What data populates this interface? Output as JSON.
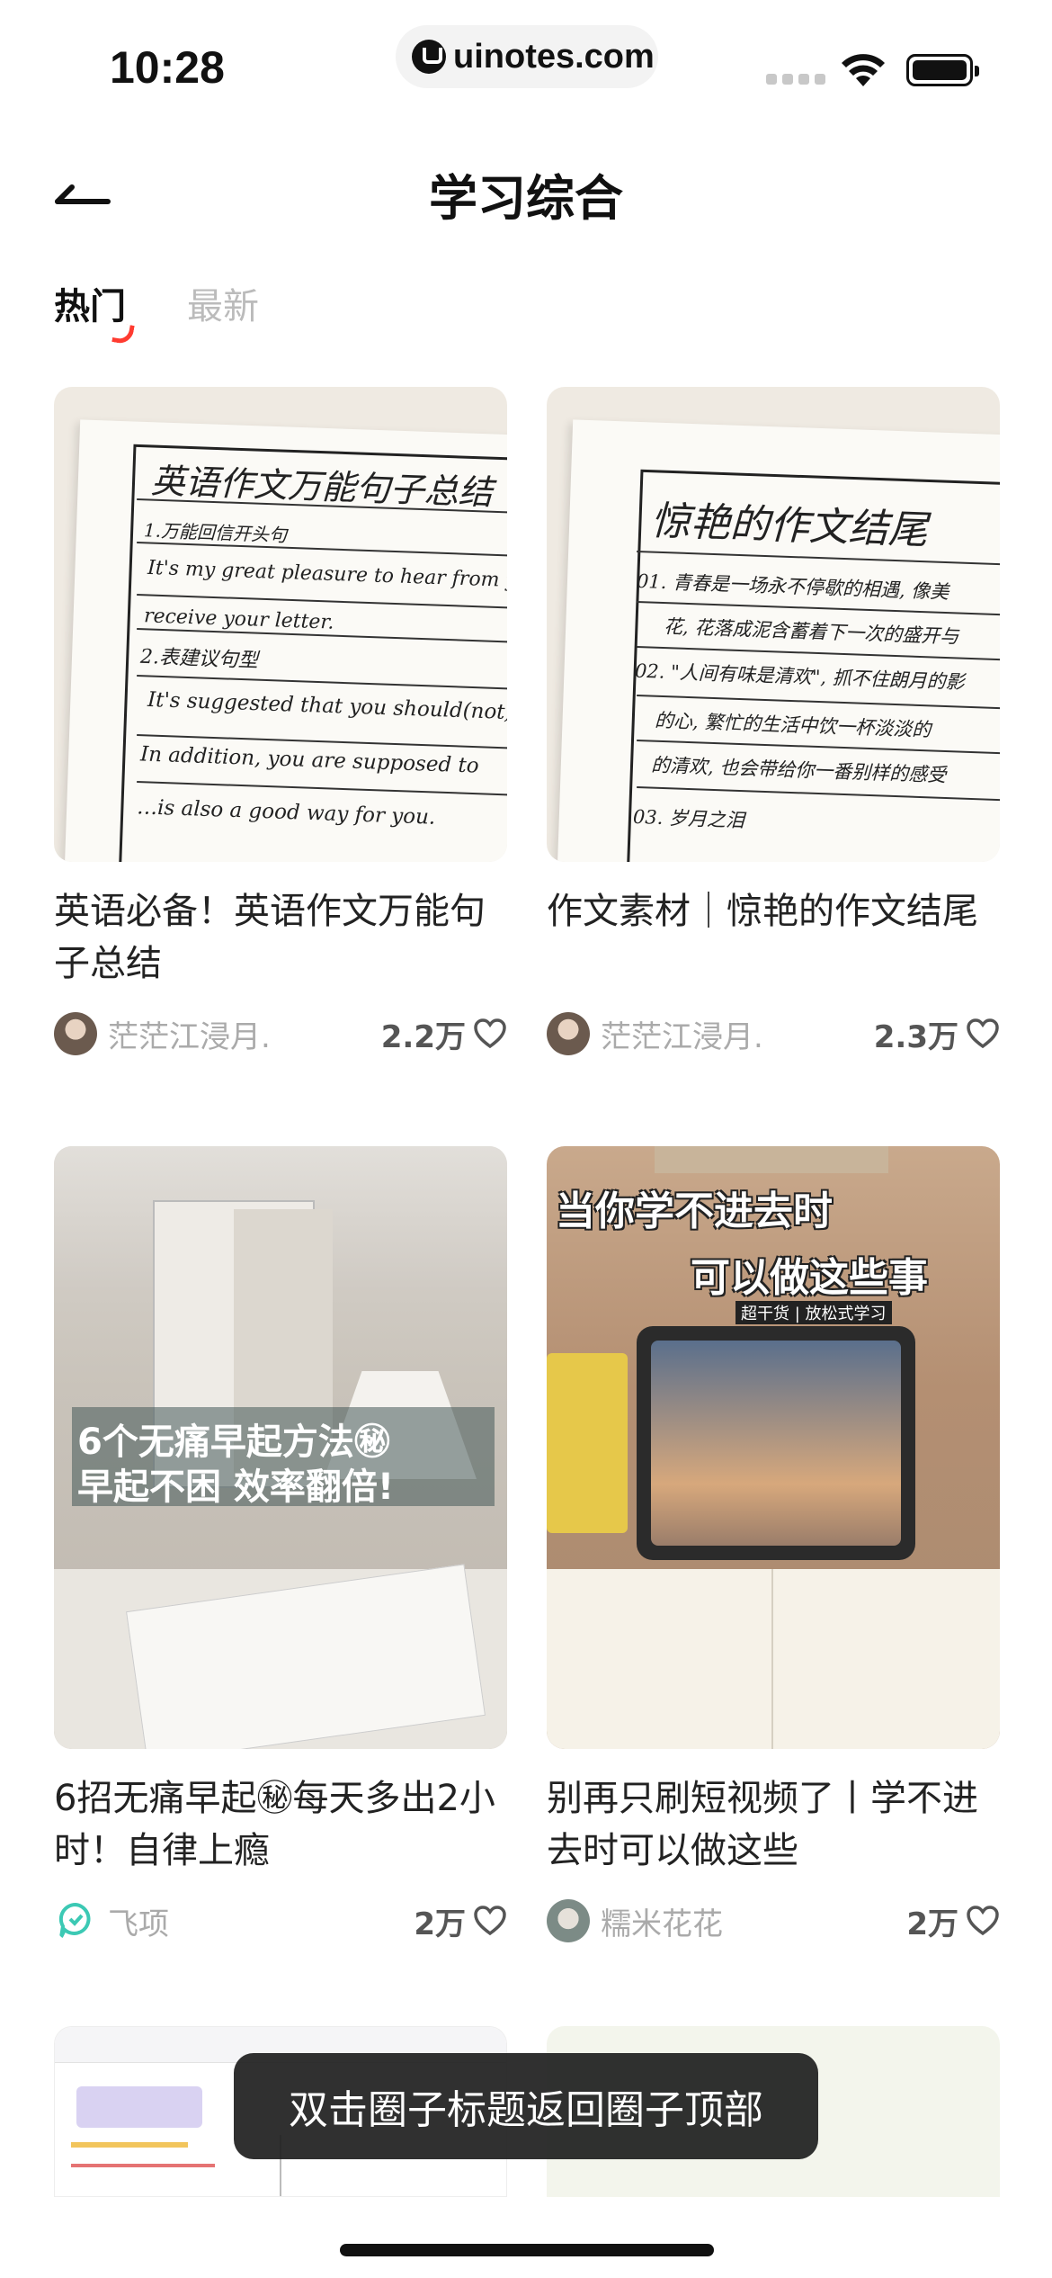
{
  "status_bar": {
    "time": "10:28",
    "url": "uinotes.com"
  },
  "header": {
    "title": "学习综合",
    "back_icon": "back-arrow-icon"
  },
  "tabs": [
    {
      "label": "热门",
      "active": true
    },
    {
      "label": "最新",
      "active": false
    }
  ],
  "cards": [
    {
      "title": "英语必备！英语作文万能句子总结",
      "author": "茫茫江浸月.",
      "likes": "2.2万",
      "image_text": {
        "heading": "英语作文万能句子总结",
        "lines": [
          "1.万能回信开头句",
          "It's my great pleasure to hear from y",
          "receive your letter.",
          "2.表建议句型",
          "It's suggested that you should(not)",
          "In addition, you are supposed to",
          "…is also a good way for you."
        ]
      }
    },
    {
      "title": "作文素材｜惊艳的作文结尾",
      "author": "茫茫江浸月.",
      "likes": "2.3万",
      "image_text": {
        "heading": "惊艳的作文结尾",
        "lines": [
          "01. 青春是一场永不停歇的相遇, 像美",
          "花, 花落成泥含蓄着下一次的盛开与",
          "02. \"人间有味是清欢\", 抓不住朗月的影",
          "的心, 繁忙的生活中饮一杯淡淡的",
          "的清欢, 也会带给你一番别样的感受",
          "03. 岁月之泪"
        ]
      }
    },
    {
      "title": "6招无痛早起㊙每天多出2小时！自律上瘾",
      "author": "飞项",
      "likes": "2万",
      "image_text": {
        "line1": "6个无痛早起方法㊙",
        "line2": "早起不困 效率翻倍!"
      }
    },
    {
      "title": "别再只刷短视频了丨学不进去时可以做这些",
      "author": "糯米花花",
      "likes": "2万",
      "image_text": {
        "line1": "当你学不进去时",
        "line2": "可以做这些事",
        "sub": "超干货 | 放松式学习"
      }
    }
  ],
  "toast": {
    "text": "双击圈子标题返回圈子顶部"
  },
  "colors": {
    "accent": "#ff3b30",
    "text_primary": "#222222",
    "text_muted": "#aaaaaa"
  }
}
